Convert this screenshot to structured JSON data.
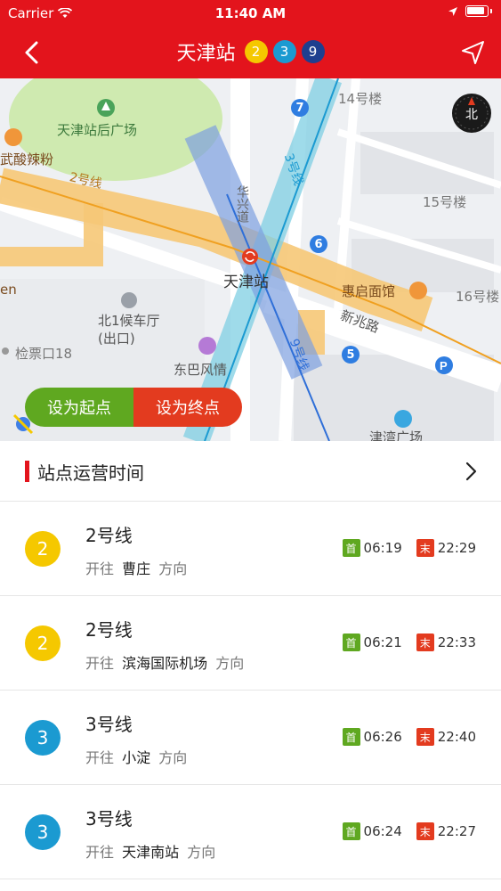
{
  "status_bar": {
    "carrier": "Carrier",
    "time": "11:40 AM"
  },
  "header": {
    "title": "天津站",
    "badges": [
      {
        "label": "2",
        "color": "#f5c800"
      },
      {
        "label": "3",
        "color": "#1b9ad1"
      },
      {
        "label": "9",
        "color": "#1e3f8f"
      }
    ],
    "back_icon": "chevron-left-icon",
    "locate_icon": "navigation-arrow-icon"
  },
  "map": {
    "labels": {
      "plaza": "天津站后广场",
      "noodle": "武酸辣粉",
      "line2": "2号线",
      "building14": "14号楼",
      "building15": "15号楼",
      "building16": "16号楼",
      "huaxing": "华兴道",
      "line3": "3号线",
      "station": "天津站",
      "huiqi": "惠启面馆",
      "xinzhao": "新兆路",
      "exit_north": "北1候车厅(出口)",
      "jianpiao": "检票口18",
      "dongba": "东巴风情",
      "en": "en",
      "line9": "9号线",
      "jinwan": "津湾广场",
      "compass": "北"
    },
    "exits": [
      "7",
      "6",
      "5"
    ],
    "set_start": "设为起点",
    "set_end": "设为终点"
  },
  "section": {
    "title": "站点运营时间"
  },
  "lines": [
    {
      "badge": "2",
      "color": "#f5c800",
      "name": "2号线",
      "prefix": "开往",
      "dest": "曹庄",
      "suffix": "方向",
      "first_label": "首",
      "first": "06:19",
      "last_label": "末",
      "last": "22:29"
    },
    {
      "badge": "2",
      "color": "#f5c800",
      "name": "2号线",
      "prefix": "开往",
      "dest": "滨海国际机场",
      "suffix": "方向",
      "first_label": "首",
      "first": "06:21",
      "last_label": "末",
      "last": "22:33"
    },
    {
      "badge": "3",
      "color": "#1b9ad1",
      "name": "3号线",
      "prefix": "开往",
      "dest": "小淀",
      "suffix": "方向",
      "first_label": "首",
      "first": "06:26",
      "last_label": "末",
      "last": "22:40"
    },
    {
      "badge": "3",
      "color": "#1b9ad1",
      "name": "3号线",
      "prefix": "开往",
      "dest": "天津南站",
      "suffix": "方向",
      "first_label": "首",
      "first": "06:24",
      "last_label": "末",
      "last": "22:27"
    }
  ]
}
